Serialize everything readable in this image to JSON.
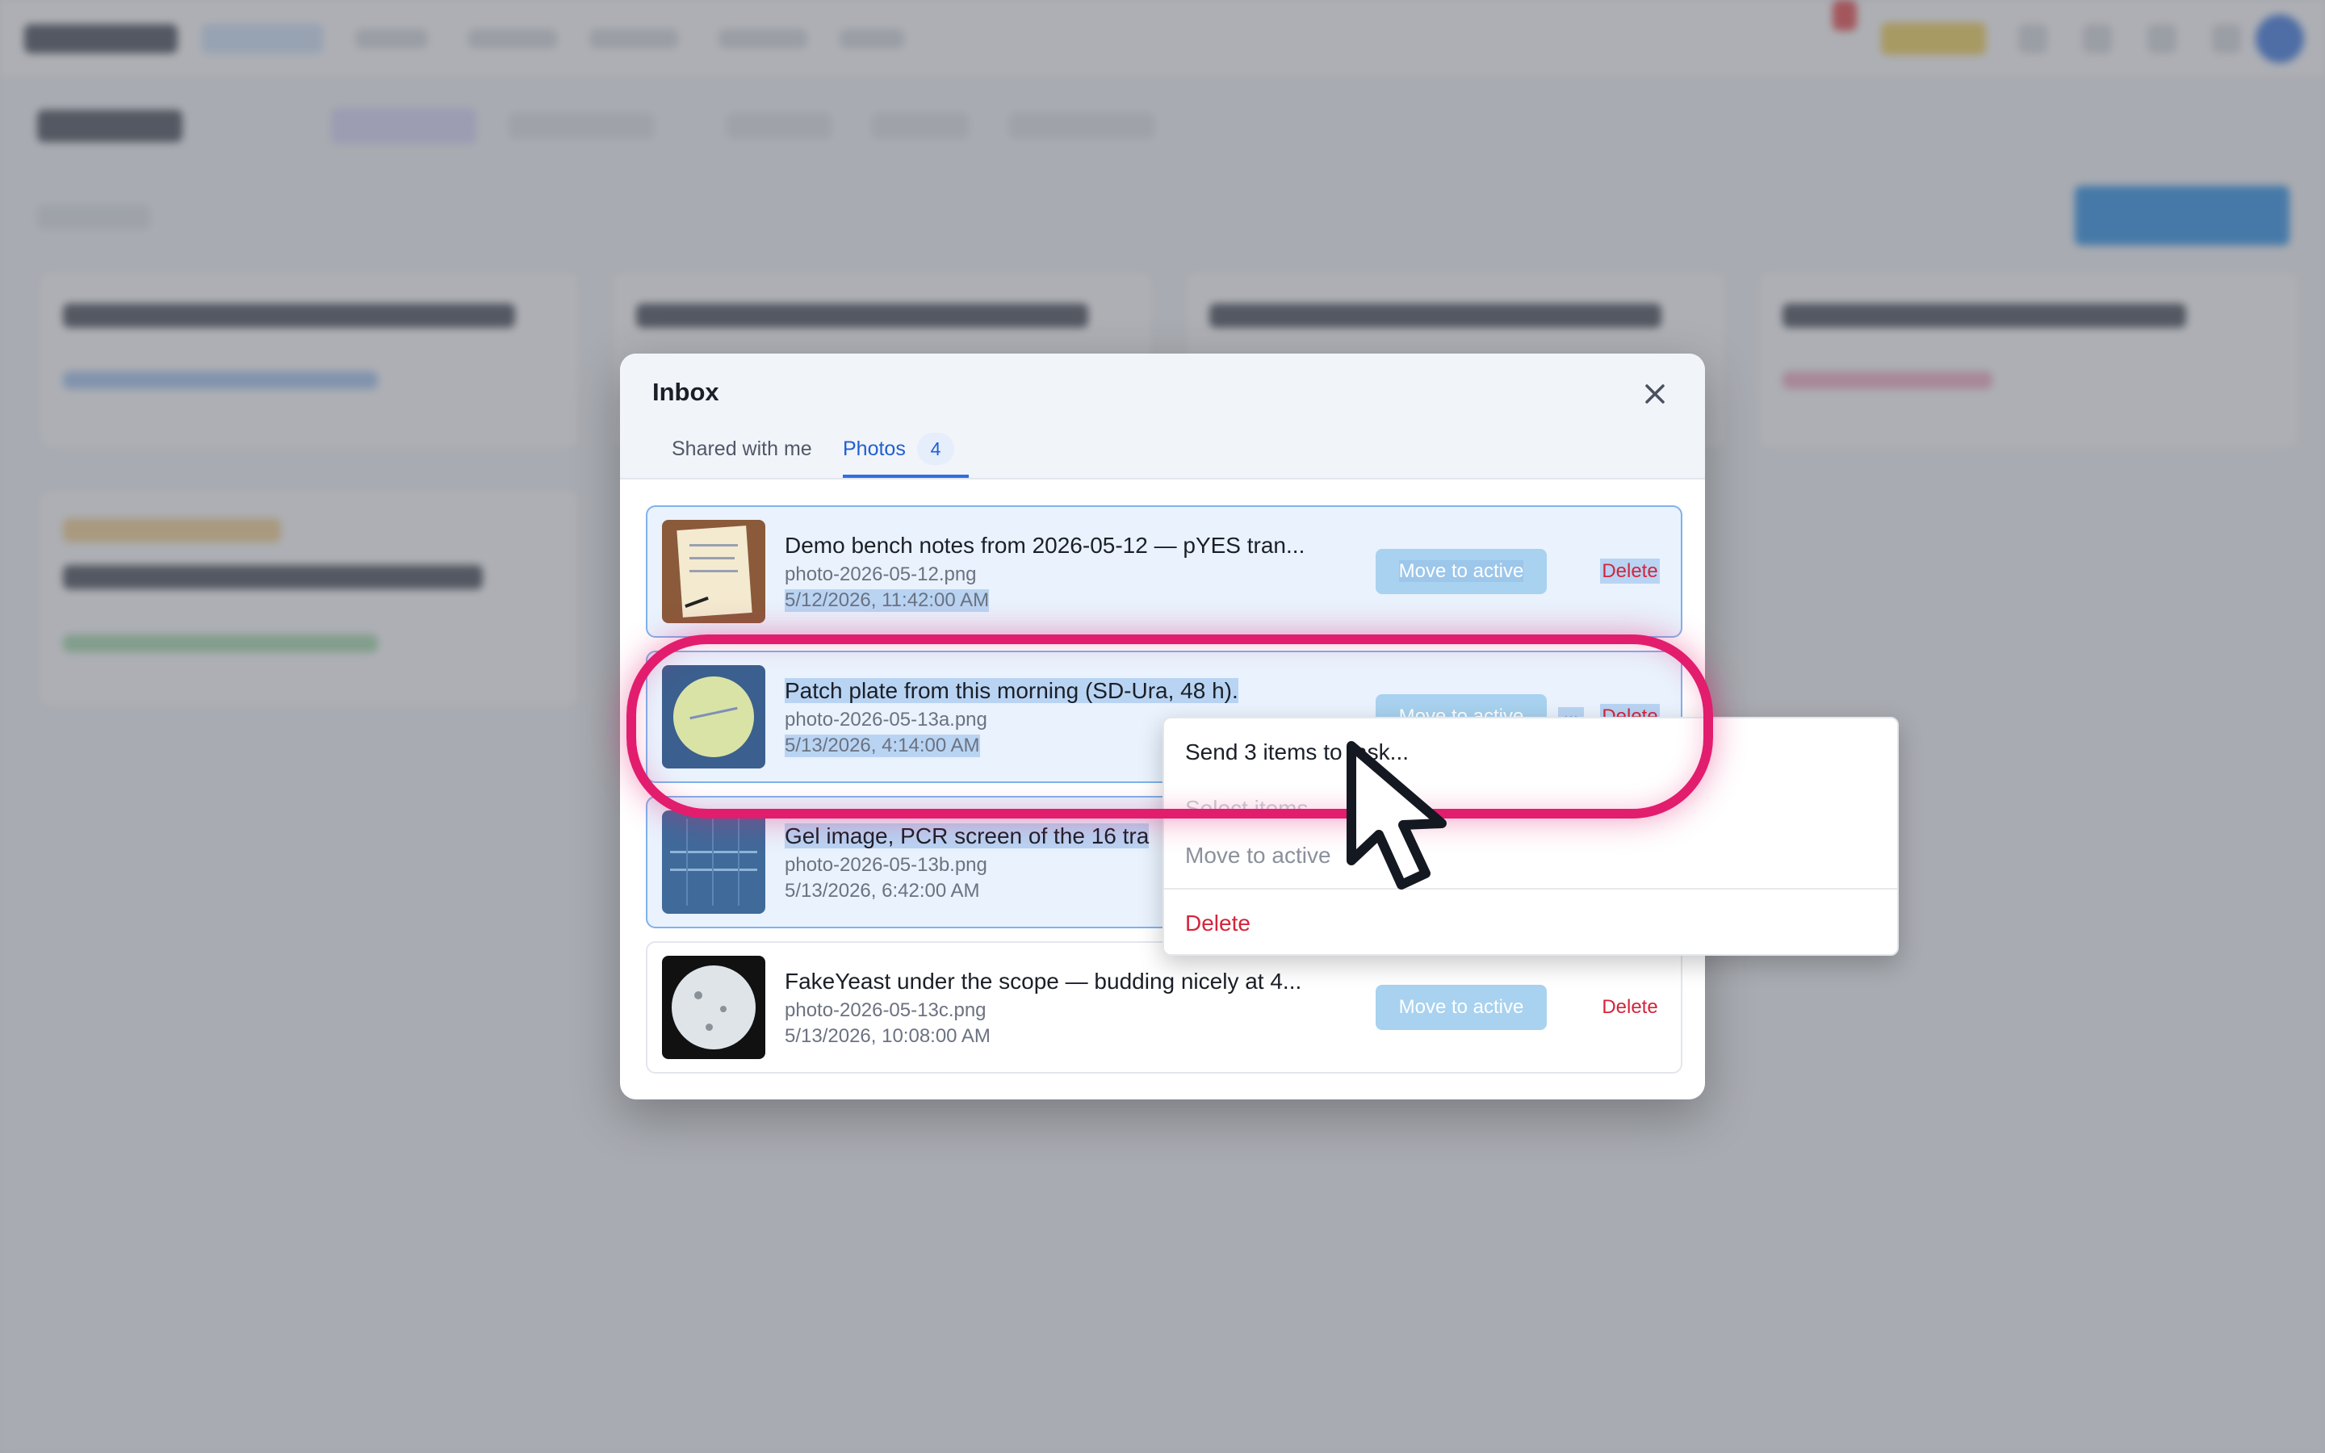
{
  "modal": {
    "title": "Inbox",
    "close_icon": "close-icon",
    "tabs": [
      {
        "label": "Shared with me",
        "active": false
      },
      {
        "label": "Photos",
        "count": "4",
        "active": true
      }
    ]
  },
  "rows": [
    {
      "title": "Demo bench notes from 2026-05-12 — pYES tran...",
      "file": "photo-2026-05-12.png",
      "date": "5/12/2026, 11:42:00 AM",
      "selected": true,
      "thumb": "notebook-photo"
    },
    {
      "title": "Patch plate from this morning (SD-Ura, 48 h).",
      "file": "photo-2026-05-13a.png",
      "date": "5/13/2026, 4:14:00 AM",
      "selected": true,
      "thumb": "petri-plate-photo"
    },
    {
      "title": "Gel image, PCR screen of the 16 tra",
      "file": "photo-2026-05-13b.png",
      "date": "5/13/2026, 6:42:00 AM",
      "selected": true,
      "thumb": "gel-photo"
    },
    {
      "title": "FakeYeast under the scope — budding nicely at 4...",
      "file": "photo-2026-05-13c.png",
      "date": "5/13/2026, 10:08:00 AM",
      "selected": false,
      "thumb": "microscope-photo"
    }
  ],
  "row_actions": {
    "move": "Move to active",
    "delete": "Delete",
    "more": "..."
  },
  "context_menu": {
    "send": "Send 3 items to task...",
    "ghost": "Select items",
    "move": "Move to active",
    "delete": "Delete"
  },
  "colors": {
    "accent": "#2f6fe0",
    "danger": "#d4243b",
    "highlight": "#e21d6e",
    "selection": "#b9d4f3"
  }
}
